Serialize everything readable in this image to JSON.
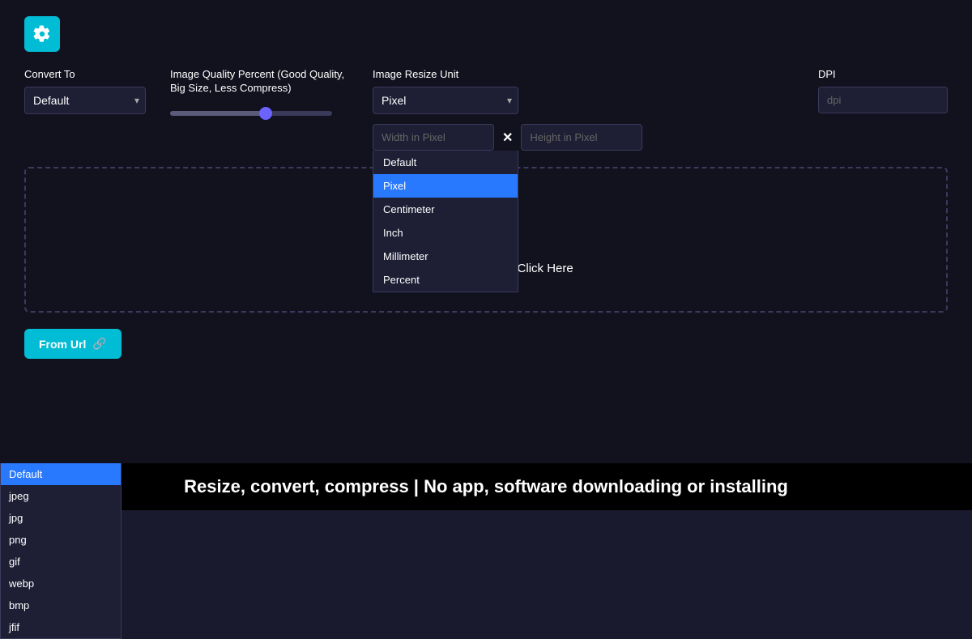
{
  "gear_button": {
    "label": "Settings"
  },
  "convert_to": {
    "label": "Convert To",
    "selected": "Default",
    "options": [
      "Default",
      "jpeg",
      "jpg",
      "png",
      "gif",
      "webp",
      "bmp",
      "jfif"
    ]
  },
  "image_quality": {
    "label": "Image Quality Percent (Good Quality, Big Size, Less Compress)",
    "value": 60,
    "min": 0,
    "max": 100
  },
  "image_resize_unit": {
    "label": "Image Resize Unit",
    "selected": "Pixel",
    "options": [
      "Default",
      "Pixel",
      "Centimeter",
      "Inch",
      "Millimeter",
      "Percent"
    ]
  },
  "width_input": {
    "placeholder": "Width in Pixel"
  },
  "times_symbol": "×",
  "height_input": {
    "placeholder": "Height in Pixel"
  },
  "dpi": {
    "label": "DPI",
    "placeholder": "dpi"
  },
  "upload_area": {
    "icon": "☁",
    "text": "Drag and Drop Or Click Here"
  },
  "from_url_button": {
    "label": "From Url"
  },
  "bottom_banner": {
    "text": "Resize, convert, compress | No app, software downloading or installing"
  }
}
